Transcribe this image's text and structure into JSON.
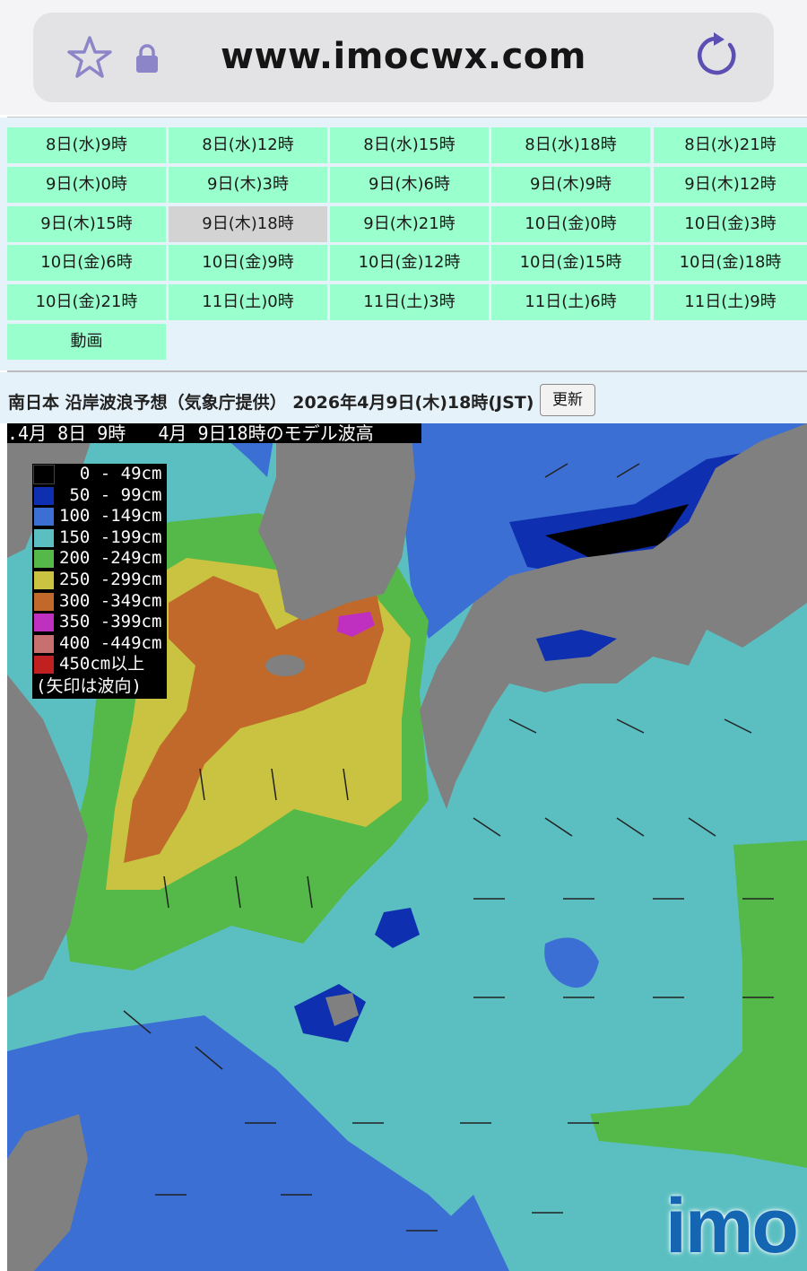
{
  "browser": {
    "url": "www.imocwx.com"
  },
  "time_grid": {
    "selected": "9日(木)18時",
    "rows": [
      [
        "8日(水)9時",
        "8日(水)12時",
        "8日(水)15時",
        "8日(水)18時",
        "8日(水)21時"
      ],
      [
        "9日(木)0時",
        "9日(木)3時",
        "9日(木)6時",
        "9日(木)9時",
        "9日(木)12時"
      ],
      [
        "9日(木)15時",
        "9日(木)18時",
        "9日(木)21時",
        "10日(金)0時",
        "10日(金)3時"
      ],
      [
        "10日(金)6時",
        "10日(金)9時",
        "10日(金)12時",
        "10日(金)15時",
        "10日(金)18時"
      ],
      [
        "10日(金)21時",
        "11日(土)0時",
        "11日(土)3時",
        "11日(土)6時",
        "11日(土)9時"
      ],
      [
        "動画"
      ]
    ]
  },
  "page": {
    "title": "南日本 沿岸波浪予想（気象庁提供） 2026年4月9日(木)18時(JST)",
    "update_button": "更新"
  },
  "map": {
    "header": ".4月 8日 9時   4月 9日18時のモデル波高",
    "legend": [
      {
        "label": "  0 - 49cm",
        "color": "#000000"
      },
      {
        "label": " 50 - 99cm",
        "color": "#0d2fb0"
      },
      {
        "label": "100 -149cm",
        "color": "#3b6fd4"
      },
      {
        "label": "150 -199cm",
        "color": "#5bbfc2"
      },
      {
        "label": "200 -249cm",
        "color": "#54b948"
      },
      {
        "label": "250 -299cm",
        "color": "#c9c341"
      },
      {
        "label": "300 -349cm",
        "color": "#c0692a"
      },
      {
        "label": "350 -399cm",
        "color": "#c030c0"
      },
      {
        "label": "400 -449cm",
        "color": "#c87070"
      },
      {
        "label": "450cm以上",
        "color": "#c02020"
      }
    ],
    "legend_note": "(矢印は波向)",
    "logo": "imo",
    "colors": {
      "land": "#808080",
      "sea_150": "#5bbfc2",
      "sea_200": "#54b948",
      "sea_250": "#c9c341",
      "sea_300": "#c0692a",
      "sea_350": "#c030c0",
      "sea_100": "#3b6fd4",
      "sea_50": "#0d2fb0"
    }
  }
}
